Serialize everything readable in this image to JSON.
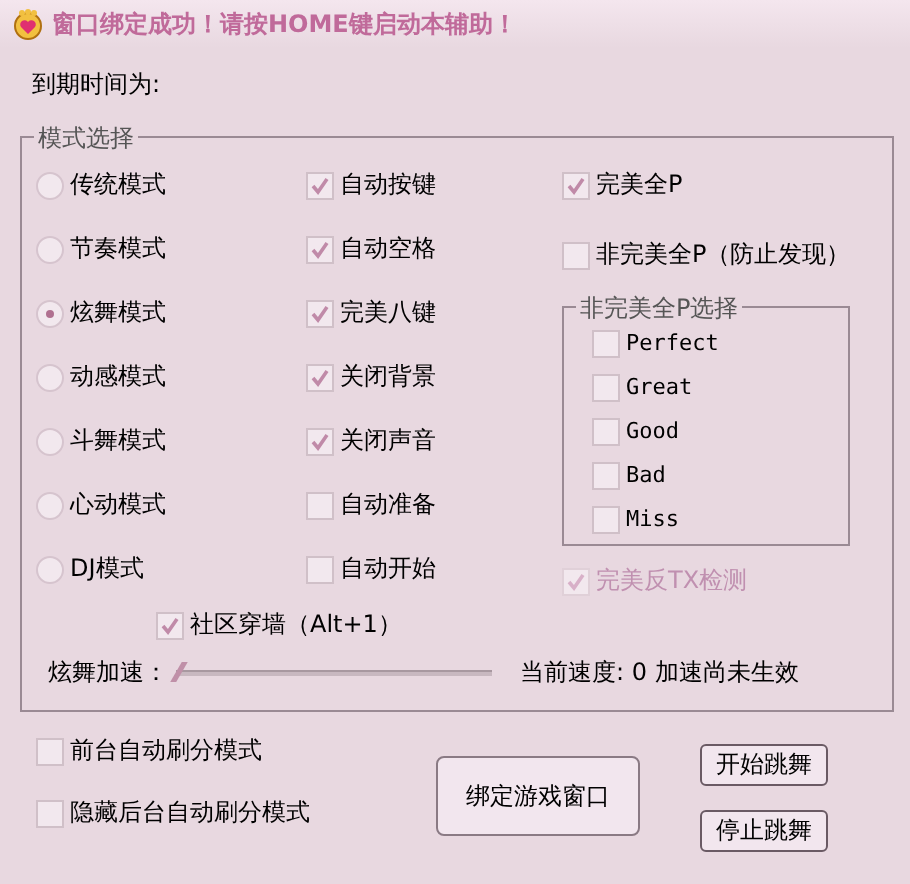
{
  "window": {
    "title": "窗口绑定成功！请按HOME键启动本辅助！"
  },
  "expiry_label": "到期时间为:",
  "mode_group": {
    "title": "模式选择",
    "modes": [
      {
        "label": "传统模式",
        "selected": false
      },
      {
        "label": "节奏模式",
        "selected": false
      },
      {
        "label": "炫舞模式",
        "selected": true
      },
      {
        "label": "动感模式",
        "selected": false
      },
      {
        "label": "斗舞模式",
        "selected": false
      },
      {
        "label": "心动模式",
        "selected": false
      },
      {
        "label": "DJ模式",
        "selected": false
      }
    ],
    "options": [
      {
        "label": "自动按键",
        "checked": true
      },
      {
        "label": "自动空格",
        "checked": true
      },
      {
        "label": "完美八键",
        "checked": true
      },
      {
        "label": "关闭背景",
        "checked": true
      },
      {
        "label": "关闭声音",
        "checked": true
      },
      {
        "label": "自动准备",
        "checked": false
      },
      {
        "label": "自动开始",
        "checked": false
      }
    ],
    "wall": {
      "label": "社区穿墙（Alt+1）",
      "checked": true
    },
    "perfect_options": [
      {
        "label": "完美全P",
        "checked": true
      },
      {
        "label": "非完美全P（防止发现）",
        "checked": false
      }
    ],
    "imperfect_group": {
      "title": "非完美全P选择",
      "items": [
        {
          "label": "Perfect",
          "checked": false
        },
        {
          "label": "Great",
          "checked": false
        },
        {
          "label": "Good",
          "checked": false
        },
        {
          "label": "Bad",
          "checked": false
        },
        {
          "label": "Miss",
          "checked": false
        }
      ]
    },
    "anti_tx": {
      "label": "完美反TX检测",
      "checked": true,
      "disabled": true
    },
    "speed": {
      "label": "炫舞加速：",
      "level": 0,
      "reading": "当前速度: 0 加速尚未生效"
    }
  },
  "bottom_options": [
    {
      "label": "前台自动刷分模式",
      "checked": false
    },
    {
      "label": "隐藏后台自动刷分模式",
      "checked": false
    }
  ],
  "bind_button": "绑定游戏窗口",
  "buttons": [
    "开始跳舞",
    "停止跳舞"
  ]
}
